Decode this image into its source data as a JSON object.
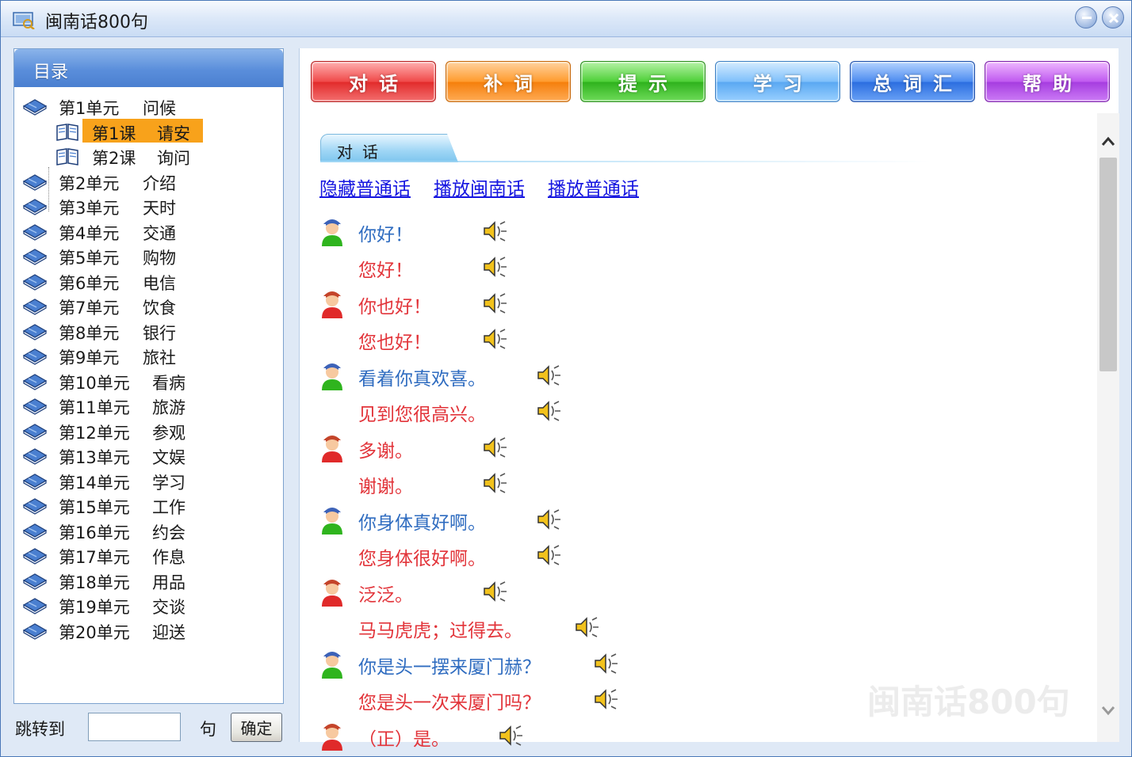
{
  "window": {
    "title": "闽南话800句"
  },
  "directory": {
    "header": "目录",
    "units_top": [
      {
        "unit": "第1单元",
        "topic": "问候"
      }
    ],
    "lessons": [
      {
        "lesson": "第1课",
        "topic": "请安",
        "selected": true
      },
      {
        "lesson": "第2课",
        "topic": "询问",
        "selected": false
      }
    ],
    "units": [
      {
        "unit": "第2单元",
        "topic": "介绍"
      },
      {
        "unit": "第3单元",
        "topic": "天时"
      },
      {
        "unit": "第4单元",
        "topic": "交通"
      },
      {
        "unit": "第5单元",
        "topic": "购物"
      },
      {
        "unit": "第6单元",
        "topic": "电信"
      },
      {
        "unit": "第7单元",
        "topic": "饮食"
      },
      {
        "unit": "第8单元",
        "topic": "银行"
      },
      {
        "unit": "第9单元",
        "topic": "旅社"
      },
      {
        "unit": "第10单元",
        "topic": "看病"
      },
      {
        "unit": "第11单元",
        "topic": "旅游"
      },
      {
        "unit": "第12单元",
        "topic": "参观"
      },
      {
        "unit": "第13单元",
        "topic": "文娱"
      },
      {
        "unit": "第14单元",
        "topic": "学习"
      },
      {
        "unit": "第15单元",
        "topic": "工作"
      },
      {
        "unit": "第16单元",
        "topic": "约会"
      },
      {
        "unit": "第17单元",
        "topic": "作息"
      },
      {
        "unit": "第18单元",
        "topic": "用品"
      },
      {
        "unit": "第19单元",
        "topic": "交谈"
      },
      {
        "unit": "第20单元",
        "topic": "迎送"
      }
    ]
  },
  "jump": {
    "label": "跳转到",
    "input_value": "",
    "unit": "句",
    "confirm": "确定"
  },
  "toolbar": {
    "buttons": [
      "对话",
      "补词",
      "提示",
      "学习",
      "总词汇",
      "帮助"
    ]
  },
  "section": {
    "tab_label": "对话",
    "links": [
      "隐藏普通话",
      "播放闽南话",
      "播放普通话"
    ]
  },
  "dialogue": [
    {
      "speaker": "blue",
      "minnan": "你好！",
      "mandarin": "您好！"
    },
    {
      "speaker": "red",
      "minnan": "你也好！",
      "mandarin": "您也好！"
    },
    {
      "speaker": "blue",
      "minnan": "看着你真欢喜。",
      "mandarin": "见到您很高兴。"
    },
    {
      "speaker": "red",
      "minnan": "多谢。",
      "mandarin": "谢谢。"
    },
    {
      "speaker": "blue",
      "minnan": "你身体真好啊。",
      "mandarin": "您身体很好啊。"
    },
    {
      "speaker": "red",
      "minnan": "泛泛。",
      "mandarin": "马马虎虎；过得去。"
    },
    {
      "speaker": "blue",
      "minnan": "你是头一摆来厦门赫？",
      "mandarin": "您是头一次来厦门吗？"
    },
    {
      "speaker": "red",
      "minnan": "（正）是。",
      "mandarin": ""
    }
  ],
  "watermark": "闽南话800句",
  "colors": {
    "minnan_text": "#2f6cc0",
    "mandarin_text": "#e2343a",
    "selected_bg": "#f8a21b",
    "link": "#1515e0"
  }
}
